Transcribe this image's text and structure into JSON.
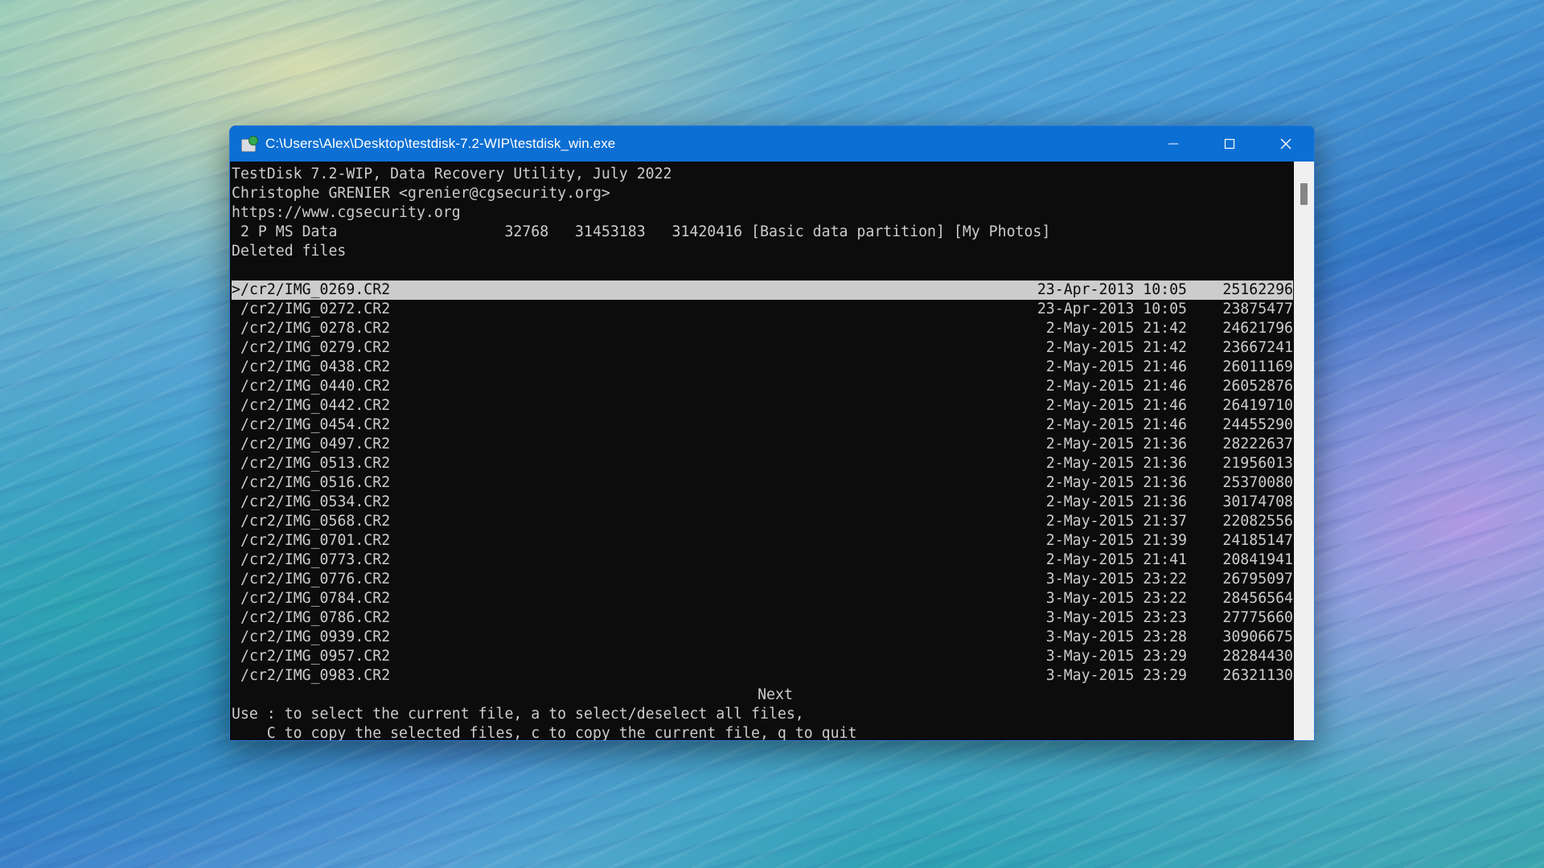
{
  "window": {
    "title": "C:\\Users\\Alex\\Desktop\\testdisk-7.2-WIP\\testdisk_win.exe",
    "icon": "testdisk-app-icon",
    "controls": {
      "minimize": "minimize-icon",
      "maximize": "maximize-icon",
      "close": "close-icon"
    },
    "titlebar_color": "#0c6fd3"
  },
  "header": {
    "line1": "TestDisk 7.2-WIP, Data Recovery Utility, July 2022",
    "line2": "Christophe GRENIER <grenier@cgsecurity.org>",
    "line3": "https://www.cgsecurity.org",
    "partition": " 2 P MS Data                   32768   31453183   31420416 [Basic data partition] [My Photos]",
    "section": "Deleted files"
  },
  "files": [
    {
      "marker": ">",
      "path": "/cr2/IMG_0269.CR2",
      "date": "23-Apr-2013 10:05",
      "size": "25162296",
      "selected": true
    },
    {
      "marker": " ",
      "path": "/cr2/IMG_0272.CR2",
      "date": "23-Apr-2013 10:05",
      "size": "23875477",
      "selected": false
    },
    {
      "marker": " ",
      "path": "/cr2/IMG_0278.CR2",
      "date": "2-May-2015 21:42",
      "size": "24621796",
      "selected": false
    },
    {
      "marker": " ",
      "path": "/cr2/IMG_0279.CR2",
      "date": "2-May-2015 21:42",
      "size": "23667241",
      "selected": false
    },
    {
      "marker": " ",
      "path": "/cr2/IMG_0438.CR2",
      "date": "2-May-2015 21:46",
      "size": "26011169",
      "selected": false
    },
    {
      "marker": " ",
      "path": "/cr2/IMG_0440.CR2",
      "date": "2-May-2015 21:46",
      "size": "26052876",
      "selected": false
    },
    {
      "marker": " ",
      "path": "/cr2/IMG_0442.CR2",
      "date": "2-May-2015 21:46",
      "size": "26419710",
      "selected": false
    },
    {
      "marker": " ",
      "path": "/cr2/IMG_0454.CR2",
      "date": "2-May-2015 21:46",
      "size": "24455290",
      "selected": false
    },
    {
      "marker": " ",
      "path": "/cr2/IMG_0497.CR2",
      "date": "2-May-2015 21:36",
      "size": "28222637",
      "selected": false
    },
    {
      "marker": " ",
      "path": "/cr2/IMG_0513.CR2",
      "date": "2-May-2015 21:36",
      "size": "21956013",
      "selected": false
    },
    {
      "marker": " ",
      "path": "/cr2/IMG_0516.CR2",
      "date": "2-May-2015 21:36",
      "size": "25370080",
      "selected": false
    },
    {
      "marker": " ",
      "path": "/cr2/IMG_0534.CR2",
      "date": "2-May-2015 21:36",
      "size": "30174708",
      "selected": false
    },
    {
      "marker": " ",
      "path": "/cr2/IMG_0568.CR2",
      "date": "2-May-2015 21:37",
      "size": "22082556",
      "selected": false
    },
    {
      "marker": " ",
      "path": "/cr2/IMG_0701.CR2",
      "date": "2-May-2015 21:39",
      "size": "24185147",
      "selected": false
    },
    {
      "marker": " ",
      "path": "/cr2/IMG_0773.CR2",
      "date": "2-May-2015 21:41",
      "size": "20841941",
      "selected": false
    },
    {
      "marker": " ",
      "path": "/cr2/IMG_0776.CR2",
      "date": "3-May-2015 23:22",
      "size": "26795097",
      "selected": false
    },
    {
      "marker": " ",
      "path": "/cr2/IMG_0784.CR2",
      "date": "3-May-2015 23:22",
      "size": "28456564",
      "selected": false
    },
    {
      "marker": " ",
      "path": "/cr2/IMG_0786.CR2",
      "date": "3-May-2015 23:23",
      "size": "27775660",
      "selected": false
    },
    {
      "marker": " ",
      "path": "/cr2/IMG_0939.CR2",
      "date": "3-May-2015 23:28",
      "size": "30906675",
      "selected": false
    },
    {
      "marker": " ",
      "path": "/cr2/IMG_0957.CR2",
      "date": "3-May-2015 23:29",
      "size": "28284430",
      "selected": false
    },
    {
      "marker": " ",
      "path": "/cr2/IMG_0983.CR2",
      "date": "3-May-2015 23:29",
      "size": "26321130",
      "selected": false
    }
  ],
  "footer": {
    "next": "Next",
    "help1": "Use : to select the current file, a to select/deselect all files,",
    "help2": "    C to copy the selected files, c to copy the current file, q to quit"
  }
}
